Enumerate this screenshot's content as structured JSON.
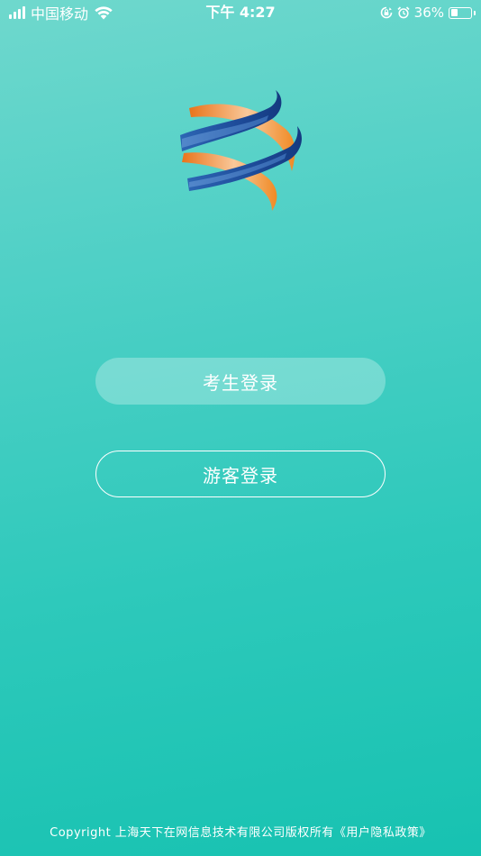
{
  "status_bar": {
    "carrier": "中国移动",
    "time": "下午 4:27",
    "battery_percent": "36%",
    "battery_level": 0.36,
    "icons": [
      "signal-icon",
      "wifi-icon",
      "orientation-lock-icon",
      "alarm-icon",
      "battery-icon"
    ]
  },
  "login": {
    "student_label": "考生登录",
    "guest_label": "游客登录"
  },
  "footer": {
    "copyright": "Copyright  上海天下在网信息技术有限公司版权所有",
    "privacy_link": "《用户隐私政策》"
  },
  "colors": {
    "background_top": "#6fd8cd",
    "background_bottom": "#17c2b1",
    "logo_blue": "#1f4f9c",
    "logo_orange": "#f08a24"
  }
}
